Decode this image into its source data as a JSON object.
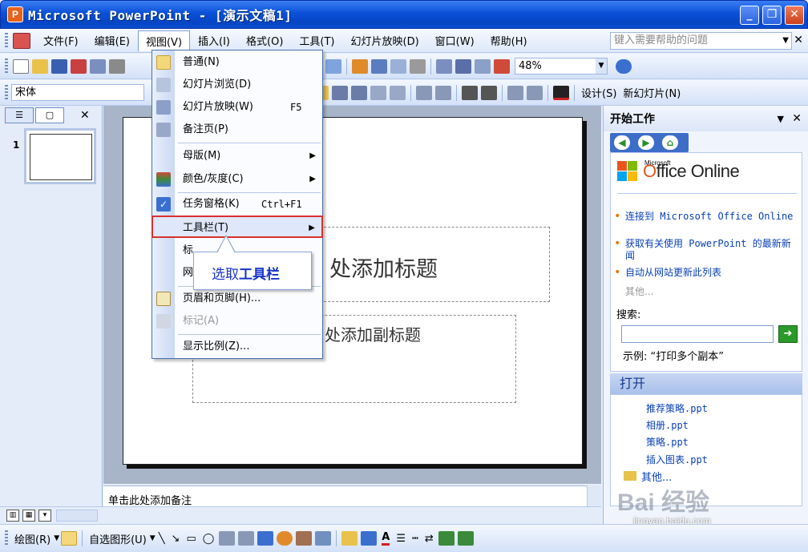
{
  "window": {
    "title": "Microsoft PowerPoint - [演示文稿1]",
    "app_icon_letter": "P"
  },
  "menubar": {
    "items": [
      "文件(F)",
      "编辑(E)",
      "视图(V)",
      "插入(I)",
      "格式(O)",
      "工具(T)",
      "幻灯片放映(D)",
      "窗口(W)",
      "帮助(H)"
    ],
    "help_placeholder": "键入需要帮助的问题"
  },
  "toolbar_standard": {
    "zoom": "48%"
  },
  "toolbar_format": {
    "font": "宋体",
    "design_label": "设计(S)",
    "new_slide_label": "新幻灯片(N)"
  },
  "slides_pane": {
    "slide_number": "1"
  },
  "slide": {
    "title_placeholder": "处添加标题",
    "subtitle_placeholder": "处添加副标题"
  },
  "notes": {
    "placeholder": "单击此处添加备注"
  },
  "view_menu": {
    "items": [
      {
        "label": "普通(N)",
        "shortcut": "",
        "submenu": false,
        "disabled": false
      },
      {
        "label": "幻灯片浏览(D)",
        "shortcut": "",
        "submenu": false,
        "disabled": false
      },
      {
        "label": "幻灯片放映(W)",
        "shortcut": "F5",
        "submenu": false,
        "disabled": false
      },
      {
        "label": "备注页(P)",
        "shortcut": "",
        "submenu": false,
        "disabled": false
      },
      {
        "label": "母版(M)",
        "shortcut": "",
        "submenu": true,
        "disabled": false
      },
      {
        "label": "颜色/灰度(C)",
        "shortcut": "",
        "submenu": true,
        "disabled": false
      },
      {
        "label": "任务窗格(K)",
        "shortcut": "Ctrl+F1",
        "submenu": false,
        "disabled": false
      },
      {
        "label": "工具栏(T)",
        "shortcut": "",
        "submenu": true,
        "disabled": false
      },
      {
        "label": "标",
        "shortcut": "",
        "submenu": false,
        "disabled": false
      },
      {
        "label": "网",
        "shortcut": "",
        "submenu": false,
        "disabled": false
      },
      {
        "label": "页眉和页脚(H)...",
        "shortcut": "",
        "submenu": false,
        "disabled": false
      },
      {
        "label": "标记(A)",
        "shortcut": "",
        "submenu": false,
        "disabled": true
      },
      {
        "label": "显示比例(Z)...",
        "shortcut": "",
        "submenu": false,
        "disabled": false
      }
    ]
  },
  "callout": {
    "prefix": "选取",
    "bold": "工具栏"
  },
  "task_pane": {
    "title": "开始工作",
    "office_small": "Microsoft",
    "office_brand_o": "O",
    "office_brand_rest": "ffice Online",
    "links": [
      "连接到 Microsoft Office Online",
      "获取有关使用 PowerPoint 的最新新闻",
      "自动从网站更新此列表"
    ],
    "more": "其他...",
    "search_label": "搜索:",
    "example": "示例: “打印多个副本”",
    "open_header": "打开",
    "open_files": [
      "推荐策略.ppt",
      "相册.ppt",
      "策略.ppt",
      "插入图表.ppt"
    ],
    "open_more": "其他..."
  },
  "drawbar": {
    "draw_label": "绘图(R)",
    "autoshapes_label": "自选图形(U)"
  },
  "watermark": {
    "brand": "Bai 经验",
    "url": "jingyan.baidu.com"
  },
  "colors": {
    "title_bar": "#0a50d8",
    "highlight_border": "#d83030",
    "link": "#0940b8",
    "callout_text": "#1834c8"
  }
}
